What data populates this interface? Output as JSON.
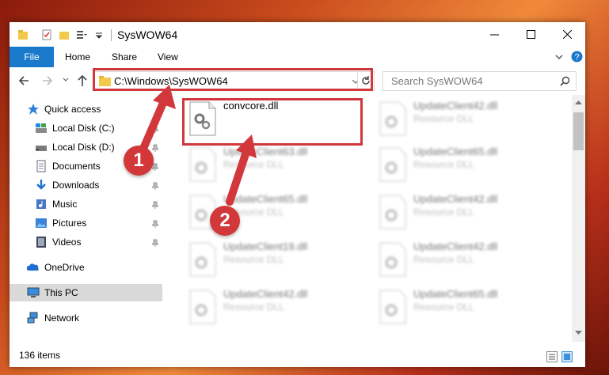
{
  "window": {
    "title": "SysWOW64"
  },
  "ribbon": {
    "file_label": "File",
    "tabs": [
      "Home",
      "Share",
      "View"
    ]
  },
  "address": {
    "path": "C:\\Windows\\SysWOW64"
  },
  "search": {
    "placeholder": "Search SysWOW64"
  },
  "sidebar": {
    "items": [
      {
        "label": "Quick access",
        "icon": "star-icon"
      },
      {
        "label": "Local Disk (C:)",
        "icon": "drive-icon",
        "pinned": true
      },
      {
        "label": "Local Disk (D:)",
        "icon": "drive-icon",
        "pinned": true
      },
      {
        "label": "Documents",
        "icon": "documents-icon",
        "pinned": true
      },
      {
        "label": "Downloads",
        "icon": "download-icon",
        "pinned": true
      },
      {
        "label": "Music",
        "icon": "music-icon",
        "pinned": true
      },
      {
        "label": "Pictures",
        "icon": "pictures-icon",
        "pinned": true
      },
      {
        "label": "Videos",
        "icon": "videos-icon",
        "pinned": true
      },
      {
        "label": "OneDrive",
        "icon": "onedrive-icon"
      },
      {
        "label": "This PC",
        "icon": "pc-icon",
        "selected": true
      },
      {
        "label": "Network",
        "icon": "network-icon"
      }
    ]
  },
  "files": {
    "highlighted": {
      "name": "convcore.dll"
    },
    "blurred": [
      {
        "name": "UpdateClient42.dll",
        "type": "Resource DLL"
      },
      {
        "name": "UpdateClient63.dll",
        "type": "Resource DLL"
      },
      {
        "name": "UpdateClient65.dll",
        "type": "Resource DLL"
      },
      {
        "name": "UpdateClient65.dll",
        "type": "Resource DLL"
      },
      {
        "name": "UpdateClient42.dll",
        "type": "Resource DLL"
      },
      {
        "name": "UpdateClient19.dll",
        "type": "Resource DLL"
      },
      {
        "name": "UpdateClient42.dll",
        "type": "Resource DLL"
      },
      {
        "name": "UpdateClient42.dll",
        "type": "Resource DLL"
      },
      {
        "name": "UpdateClient65.dll",
        "type": "Resource DLL"
      }
    ]
  },
  "status": {
    "items": "136 items"
  },
  "annotations": {
    "step1": "1",
    "step2": "2"
  },
  "colors": {
    "accent": "#1979ca",
    "highlight": "#d1373b"
  }
}
